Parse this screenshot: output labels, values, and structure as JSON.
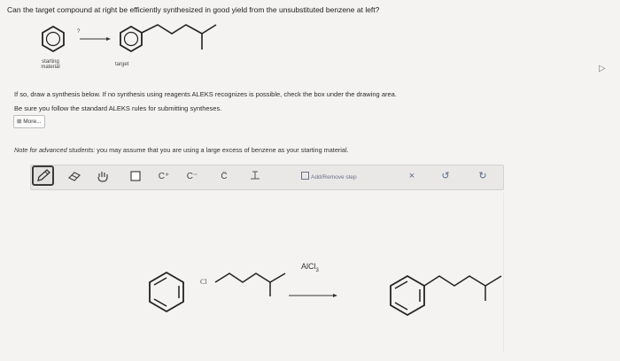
{
  "question": "Can the target compound at right be efficiently synthesized in good yield from the unsubstituted benzene at left?",
  "scheme": {
    "arrow_label": "?",
    "starting_label_1": "starting",
    "starting_label_2": "material",
    "target_label": "target"
  },
  "instructions": {
    "line1": "If so, draw a synthesis below. If no synthesis using reagents ALEKS recognizes is possible, check the box under the drawing area.",
    "line2": "Be sure you follow the standard ALEKS rules for submitting syntheses.",
    "more_label": "More..."
  },
  "note": {
    "prefix": "Note for advanced students:",
    "text": " you may assume that you are using a large excess of benzene as your starting material."
  },
  "toolbar": {
    "carbocation": "C⁺",
    "carbanion": "C⁻",
    "radical": "C̈",
    "add_remove_label": "Add/Remove step",
    "close": "×",
    "undo": "↺",
    "redo": "↻"
  },
  "drawing": {
    "reagent_main": "AlCl",
    "reagent_sub": "3",
    "chloro_label": "Cl"
  }
}
